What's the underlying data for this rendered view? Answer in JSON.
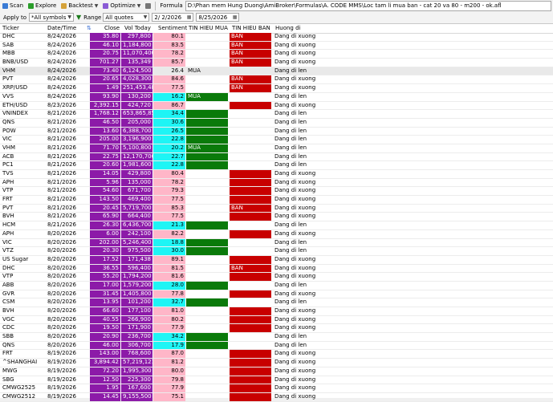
{
  "toolbar": {
    "scan_label": "Scan",
    "explore_label": "Explore",
    "backtest_label": "Backtest",
    "optimize_label": "Optimize",
    "formula_label": "Formula",
    "formula_path": "D:\\Phan mem Hung Duong\\AmiBroker\\Formulas\\A. CODE MMS\\Loc tam li mua ban - cat 20 va 80 - m200 - ok.afl",
    "apply_to_label": "Apply to",
    "apply_to_value": "*All symbols",
    "range_label": "Range",
    "range_value": "All quotes",
    "date_from": "2/ 2/2026",
    "date_to": "8/25/2026"
  },
  "colors": {
    "purple": "#8c1aa8",
    "pink": "#ffb6c8",
    "cyan": "#1ef5f5",
    "green": "#0a7a0a",
    "red": "#c80000"
  },
  "columns": [
    "Ticker",
    "Date/Time",
    "Close",
    "Vol Today",
    "Sentiment",
    "TIN HIEU MUA",
    "TIN HIEU BAN",
    "Huong di"
  ],
  "rows": [
    {
      "ticker": "DHC",
      "date": "8/24/2026",
      "close": "35.80",
      "vol": "297,800",
      "sent": "80.1",
      "sent_color": "pink",
      "mua": "",
      "mua_color": "",
      "ban": "BAN",
      "ban_color": "red",
      "huong": "Dang di xuong"
    },
    {
      "ticker": "SAB",
      "date": "8/24/2026",
      "close": "46.10",
      "vol": "1,184,800",
      "sent": "83.5",
      "sent_color": "pink",
      "mua": "",
      "mua_color": "",
      "ban": "BAN",
      "ban_color": "red",
      "huong": "Dang di xuong"
    },
    {
      "ticker": "MBB",
      "date": "8/24/2026",
      "close": "20.75",
      "vol": "11,070,400",
      "sent": "78.2",
      "sent_color": "pink",
      "mua": "",
      "mua_color": "",
      "ban": "BAN",
      "ban_color": "red",
      "huong": "Dang di xuong"
    },
    {
      "ticker": "BNB/USD",
      "date": "8/24/2026",
      "close": "701.27",
      "vol": "135,349",
      "sent": "85.7",
      "sent_color": "pink",
      "mua": "",
      "mua_color": "",
      "ban": "BAN",
      "ban_color": "red",
      "huong": "Dang di xuong"
    },
    {
      "ticker": "VHM",
      "date": "8/24/2026",
      "close": "73.40",
      "vol": "6,124,500",
      "sent": "26.4",
      "sent_color": "",
      "mua": "MUA",
      "mua_color": "",
      "ban": "",
      "ban_color": "",
      "huong": "Dang di len",
      "selected": true
    },
    {
      "ticker": "PVT",
      "date": "8/24/2026",
      "close": "20.65",
      "vol": "4,028,300",
      "sent": "84.6",
      "sent_color": "pink",
      "mua": "",
      "mua_color": "",
      "ban": "BAN",
      "ban_color": "red",
      "huong": "Dang di xuong"
    },
    {
      "ticker": "XRP/USD",
      "date": "8/24/2026",
      "close": "1.49",
      "vol": "251,453,488",
      "sent": "77.5",
      "sent_color": "pink",
      "mua": "",
      "mua_color": "",
      "ban": "BAN",
      "ban_color": "red",
      "huong": "Dang di xuong"
    },
    {
      "ticker": "VVS",
      "date": "8/24/2026",
      "close": "93.90",
      "vol": "130,200",
      "sent": "16.2",
      "sent_color": "cyan",
      "mua": "MUA",
      "mua_color": "green",
      "ban": "",
      "ban_color": "",
      "huong": "Dang di len"
    },
    {
      "ticker": "ETH/USD",
      "date": "8/23/2026",
      "close": "2,392.15",
      "vol": "424,720",
      "sent": "86.7",
      "sent_color": "pink",
      "mua": "",
      "mua_color": "",
      "ban": "",
      "ban_color": "red",
      "huong": "Dang di xuong"
    },
    {
      "ticker": "VNINDEX",
      "date": "8/21/2026",
      "close": "1,768.12",
      "vol": "653,865,856",
      "sent": "34.4",
      "sent_color": "cyan",
      "mua": "",
      "mua_color": "green",
      "ban": "",
      "ban_color": "",
      "huong": "Dang di len"
    },
    {
      "ticker": "QNS",
      "date": "8/21/2026",
      "close": "46.50",
      "vol": "205,000",
      "sent": "30.6",
      "sent_color": "cyan",
      "mua": "",
      "mua_color": "green",
      "ban": "",
      "ban_color": "",
      "huong": "Dang di len"
    },
    {
      "ticker": "POW",
      "date": "8/21/2026",
      "close": "13.60",
      "vol": "6,388,700",
      "sent": "26.5",
      "sent_color": "cyan",
      "mua": "",
      "mua_color": "green",
      "ban": "",
      "ban_color": "",
      "huong": "Dang di len"
    },
    {
      "ticker": "VIC",
      "date": "8/21/2026",
      "close": "205.00",
      "vol": "3,196,900",
      "sent": "22.8",
      "sent_color": "cyan",
      "mua": "",
      "mua_color": "green",
      "ban": "",
      "ban_color": "",
      "huong": "Dang di len"
    },
    {
      "ticker": "VHM",
      "date": "8/21/2026",
      "close": "71.70",
      "vol": "5,100,800",
      "sent": "20.2",
      "sent_color": "cyan",
      "mua": "MUA",
      "mua_color": "green",
      "ban": "",
      "ban_color": "",
      "huong": "Dang di len"
    },
    {
      "ticker": "ACB",
      "date": "8/21/2026",
      "close": "22.75",
      "vol": "12,170,700",
      "sent": "22.7",
      "sent_color": "cyan",
      "mua": "",
      "mua_color": "green",
      "ban": "",
      "ban_color": "",
      "huong": "Dang di len"
    },
    {
      "ticker": "PC1",
      "date": "8/21/2026",
      "close": "20.60",
      "vol": "1,981,600",
      "sent": "22.8",
      "sent_color": "cyan",
      "mua": "",
      "mua_color": "green",
      "ban": "",
      "ban_color": "",
      "huong": "Dang di len"
    },
    {
      "ticker": "TVS",
      "date": "8/21/2026",
      "close": "14.05",
      "vol": "429,800",
      "sent": "80.4",
      "sent_color": "pink",
      "mua": "",
      "mua_color": "",
      "ban": "",
      "ban_color": "red",
      "huong": "Dang di xuong"
    },
    {
      "ticker": "APH",
      "date": "8/21/2026",
      "close": "5.96",
      "vol": "135,000",
      "sent": "78.2",
      "sent_color": "pink",
      "mua": "",
      "mua_color": "",
      "ban": "",
      "ban_color": "red",
      "huong": "Dang di xuong"
    },
    {
      "ticker": "VTP",
      "date": "8/21/2026",
      "close": "54.60",
      "vol": "671,700",
      "sent": "79.3",
      "sent_color": "pink",
      "mua": "",
      "mua_color": "",
      "ban": "",
      "ban_color": "red",
      "huong": "Dang di xuong"
    },
    {
      "ticker": "FRT",
      "date": "8/21/2026",
      "close": "143.50",
      "vol": "469,400",
      "sent": "77.5",
      "sent_color": "pink",
      "mua": "",
      "mua_color": "",
      "ban": "",
      "ban_color": "red",
      "huong": "Dang di xuong"
    },
    {
      "ticker": "PVT",
      "date": "8/21/2026",
      "close": "20.45",
      "vol": "5,719,700",
      "sent": "85.3",
      "sent_color": "pink",
      "mua": "",
      "mua_color": "",
      "ban": "BAN",
      "ban_color": "red",
      "huong": "Dang di xuong"
    },
    {
      "ticker": "BVH",
      "date": "8/21/2026",
      "close": "65.90",
      "vol": "664,400",
      "sent": "77.5",
      "sent_color": "pink",
      "mua": "",
      "mua_color": "",
      "ban": "",
      "ban_color": "red",
      "huong": "Dang di xuong"
    },
    {
      "ticker": "HCM",
      "date": "8/21/2026",
      "close": "26.30",
      "vol": "6,436,700",
      "sent": "21.3",
      "sent_color": "cyan",
      "mua": "",
      "mua_color": "green",
      "ban": "",
      "ban_color": "",
      "huong": "Dang di len"
    },
    {
      "ticker": "APH",
      "date": "8/20/2026",
      "close": "6.00",
      "vol": "242,100",
      "sent": "82.2",
      "sent_color": "pink",
      "mua": "",
      "mua_color": "",
      "ban": "",
      "ban_color": "red",
      "huong": "Dang di xuong"
    },
    {
      "ticker": "VIC",
      "date": "8/20/2026",
      "close": "202.00",
      "vol": "5,246,400",
      "sent": "18.8",
      "sent_color": "cyan",
      "mua": "",
      "mua_color": "green",
      "ban": "",
      "ban_color": "",
      "huong": "Dang di len"
    },
    {
      "ticker": "VTZ",
      "date": "8/20/2026",
      "close": "20.30",
      "vol": "975,500",
      "sent": "30.0",
      "sent_color": "cyan",
      "mua": "",
      "mua_color": "green",
      "ban": "",
      "ban_color": "",
      "huong": "Dang di len"
    },
    {
      "ticker": "US Sugar",
      "date": "8/20/2026",
      "close": "17.52",
      "vol": "171,438",
      "sent": "89.1",
      "sent_color": "pink",
      "mua": "",
      "mua_color": "",
      "ban": "",
      "ban_color": "red",
      "huong": "Dang di xuong"
    },
    {
      "ticker": "DHC",
      "date": "8/20/2026",
      "close": "36.55",
      "vol": "596,400",
      "sent": "81.5",
      "sent_color": "pink",
      "mua": "",
      "mua_color": "",
      "ban": "BAN",
      "ban_color": "red",
      "huong": "Dang di xuong"
    },
    {
      "ticker": "VTP",
      "date": "8/20/2026",
      "close": "55.20",
      "vol": "1,794,200",
      "sent": "81.6",
      "sent_color": "pink",
      "mua": "",
      "mua_color": "",
      "ban": "",
      "ban_color": "red",
      "huong": "Dang di xuong"
    },
    {
      "ticker": "ABB",
      "date": "8/20/2026",
      "close": "17.00",
      "vol": "1,579,200",
      "sent": "28.0",
      "sent_color": "cyan",
      "mua": "",
      "mua_color": "green",
      "ban": "",
      "ban_color": "",
      "huong": "Dang di len"
    },
    {
      "ticker": "GVR",
      "date": "8/20/2026",
      "close": "31.45",
      "vol": "1,405,800",
      "sent": "77.8",
      "sent_color": "pink",
      "mua": "",
      "mua_color": "",
      "ban": "",
      "ban_color": "red",
      "huong": "Dang di xuong"
    },
    {
      "ticker": "CSM",
      "date": "8/20/2026",
      "close": "13.95",
      "vol": "101,200",
      "sent": "32.7",
      "sent_color": "cyan",
      "mua": "",
      "mua_color": "green",
      "ban": "",
      "ban_color": "",
      "huong": "Dang di len"
    },
    {
      "ticker": "BVH",
      "date": "8/20/2026",
      "close": "66.60",
      "vol": "177,100",
      "sent": "81.0",
      "sent_color": "pink",
      "mua": "",
      "mua_color": "",
      "ban": "",
      "ban_color": "red",
      "huong": "Dang di xuong"
    },
    {
      "ticker": "VGC",
      "date": "8/20/2026",
      "close": "40.55",
      "vol": "266,900",
      "sent": "80.2",
      "sent_color": "pink",
      "mua": "",
      "mua_color": "",
      "ban": "",
      "ban_color": "red",
      "huong": "Dang di xuong"
    },
    {
      "ticker": "CDC",
      "date": "8/20/2026",
      "close": "19.50",
      "vol": "171,900",
      "sent": "77.9",
      "sent_color": "pink",
      "mua": "",
      "mua_color": "",
      "ban": "",
      "ban_color": "red",
      "huong": "Dang di xuong"
    },
    {
      "ticker": "SBB",
      "date": "8/20/2026",
      "close": "20.90",
      "vol": "236,700",
      "sent": "34.2",
      "sent_color": "cyan",
      "mua": "",
      "mua_color": "green",
      "ban": "",
      "ban_color": "",
      "huong": "Dang di len"
    },
    {
      "ticker": "QNS",
      "date": "8/20/2026",
      "close": "46.00",
      "vol": "306,700",
      "sent": "17.9",
      "sent_color": "cyan",
      "mua": "",
      "mua_color": "green",
      "ban": "",
      "ban_color": "",
      "huong": "Dang di len"
    },
    {
      "ticker": "FRT",
      "date": "8/19/2026",
      "close": "143.00",
      "vol": "768,600",
      "sent": "87.0",
      "sent_color": "pink",
      "mua": "",
      "mua_color": "",
      "ban": "",
      "ban_color": "red",
      "huong": "Dang di xuong"
    },
    {
      "ticker": "^SHANGHAI",
      "date": "8/19/2026",
      "close": "3,894.42",
      "vol": "57,219,121,...",
      "sent": "81.2",
      "sent_color": "pink",
      "mua": "",
      "mua_color": "",
      "ban": "",
      "ban_color": "red",
      "huong": "Dang di xuong"
    },
    {
      "ticker": "MWG",
      "date": "8/19/2026",
      "close": "72.20",
      "vol": "1,995,300",
      "sent": "80.0",
      "sent_color": "pink",
      "mua": "",
      "mua_color": "",
      "ban": "",
      "ban_color": "red",
      "huong": "Dang di xuong"
    },
    {
      "ticker": "SBG",
      "date": "8/19/2026",
      "close": "12.50",
      "vol": "225,300",
      "sent": "79.8",
      "sent_color": "pink",
      "mua": "",
      "mua_color": "",
      "ban": "",
      "ban_color": "red",
      "huong": "Dang di xuong"
    },
    {
      "ticker": "CMWG2525",
      "date": "8/19/2026",
      "close": "1.95",
      "vol": "167,600",
      "sent": "77.9",
      "sent_color": "pink",
      "mua": "",
      "mua_color": "",
      "ban": "",
      "ban_color": "red",
      "huong": "Dang di xuong"
    },
    {
      "ticker": "CMWG2512",
      "date": "8/19/2026",
      "close": "14.45",
      "vol": "9,155,500",
      "sent": "75.1",
      "sent_color": "pink",
      "mua": "",
      "mua_color": "",
      "ban": "",
      "ban_color": "red",
      "huong": "Dang di xuong"
    }
  ]
}
